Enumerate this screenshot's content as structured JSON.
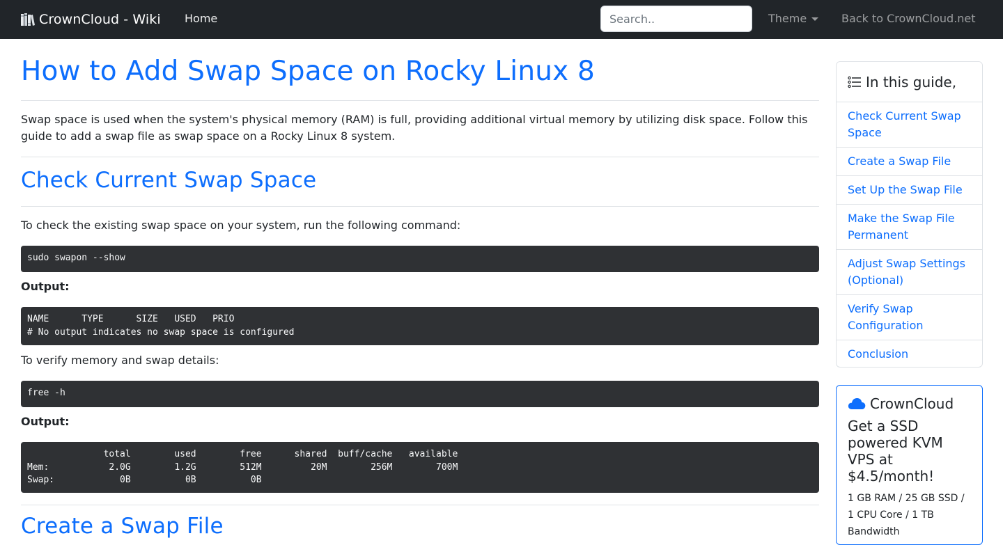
{
  "navbar": {
    "brand": "CrownCloud - Wiki",
    "home": "Home",
    "search_placeholder": "Search..",
    "theme": "Theme",
    "back": "Back to CrownCloud.net"
  },
  "article": {
    "title": "How to Add Swap Space on Rocky Linux 8",
    "intro": "Swap space is used when the system's physical memory (RAM) is full, providing additional virtual memory by utilizing disk space. Follow this guide to add a swap file as swap space on a Rocky Linux 8 system.",
    "section1": {
      "heading": "Check Current Swap Space",
      "text1": "To check the existing swap space on your system, run the following command:",
      "cmd1": "sudo swapon --show",
      "output_label1": "Output:",
      "out1": "NAME      TYPE      SIZE   USED   PRIO\n# No output indicates no swap space is configured",
      "text2": "To verify memory and swap details:",
      "cmd2": "free -h",
      "output_label2": "Output:",
      "out2": "              total        used        free      shared  buff/cache   available\nMem:           2.0G        1.2G        512M         20M        256M        700M\nSwap:            0B          0B          0B"
    },
    "section2": {
      "heading": "Create a Swap File"
    }
  },
  "toc": {
    "heading": "In this guide,",
    "items": [
      "Check Current Swap Space",
      "Create a Swap File",
      "Set Up the Swap File",
      "Make the Swap File Permanent",
      "Adjust Swap Settings (Optional)",
      "Verify Swap Configuration",
      "Conclusion"
    ]
  },
  "promo": {
    "brand": "CrownCloud",
    "headline": "Get a SSD powered KVM VPS at $4.5/month!",
    "text": "1 GB RAM / 25 GB SSD / 1 CPU Core / 1 TB Bandwidth"
  },
  "colors": {
    "navbar_bg": "#212529",
    "link": "#0d6efd",
    "code_bg": "#2f3134"
  },
  "icons": {
    "brand": "books-icon",
    "toc": "list-icon",
    "promo": "cloud-icon"
  }
}
